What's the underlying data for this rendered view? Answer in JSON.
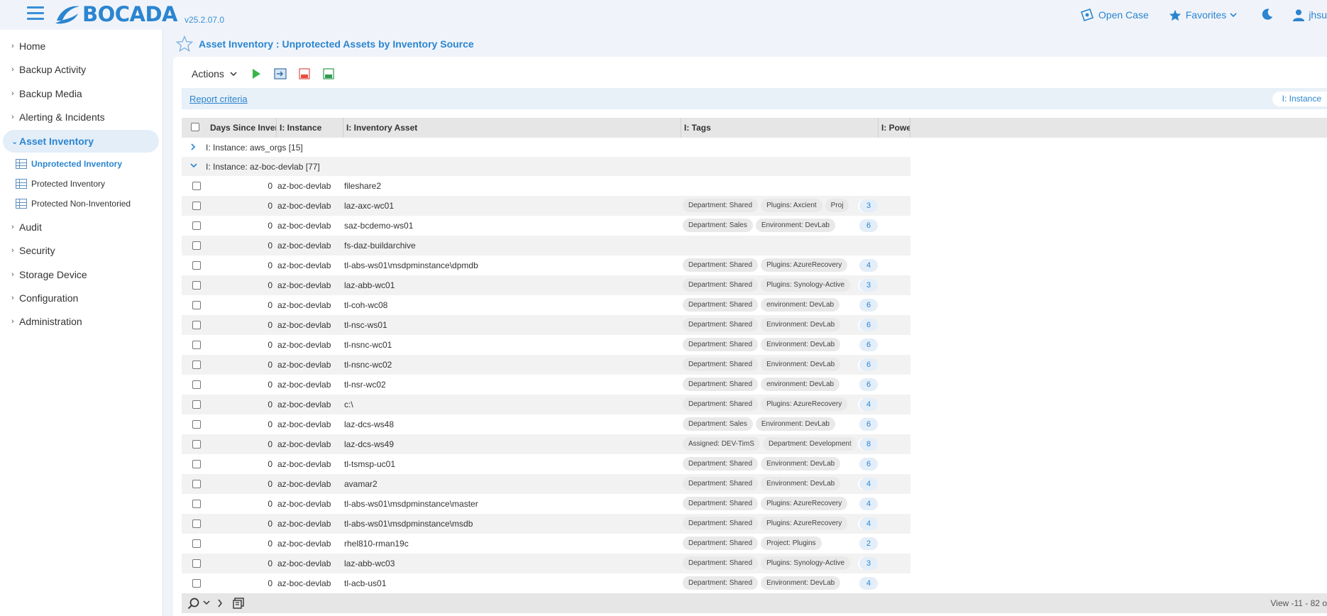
{
  "app": {
    "logo_text": "BOCADA",
    "version": "v25.2.07.0",
    "open_case_label": "Open Case",
    "favorites_label": "Favorites",
    "user_label": "jhsu",
    "accent": "#2b85d0"
  },
  "sidebar": {
    "items": [
      {
        "label": "Home"
      },
      {
        "label": "Backup Activity"
      },
      {
        "label": "Backup Media"
      },
      {
        "label": "Alerting & Incidents"
      },
      {
        "label": "Asset Inventory"
      },
      {
        "label": "Audit"
      },
      {
        "label": "Security"
      },
      {
        "label": "Storage Device"
      },
      {
        "label": "Configuration"
      },
      {
        "label": "Administration"
      }
    ],
    "subitems": [
      {
        "label": "Unprotected Inventory"
      },
      {
        "label": "Protected Inventory"
      },
      {
        "label": "Protected Non-Inventoried"
      }
    ]
  },
  "page": {
    "title": "Asset Inventory : Unprotected Assets by Inventory Source",
    "actions_label": "Actions",
    "report_criteria": "Report criteria",
    "group_chip": "I: Instance"
  },
  "grid": {
    "columns": [
      "Days Since Invent",
      "I: Instance",
      "I: Inventory Asset",
      "I: Tags",
      "I: Power"
    ],
    "groups": [
      {
        "label": "I: Instance: aws_orgs [15]",
        "expanded": false
      },
      {
        "label": "I: Instance: az-boc-devlab [77]",
        "expanded": true
      }
    ],
    "rows": [
      {
        "days": "0",
        "instance": "az-boc-devlab",
        "asset": "fileshare2",
        "tags": [],
        "count": ""
      },
      {
        "days": "0",
        "instance": "az-boc-devlab",
        "asset": "laz-axc-wc01",
        "tags": [
          "Department: Shared",
          "Plugins: Axcient",
          "Proj"
        ],
        "count": "3"
      },
      {
        "days": "0",
        "instance": "az-boc-devlab",
        "asset": "saz-bcdemo-ws01",
        "tags": [
          "Department: Sales",
          "Environment: DevLab"
        ],
        "count": "6"
      },
      {
        "days": "0",
        "instance": "az-boc-devlab",
        "asset": "fs-daz-buildarchive",
        "tags": [],
        "count": ""
      },
      {
        "days": "0",
        "instance": "az-boc-devlab",
        "asset": "tl-abs-ws01\\msdpminstance\\dpmdb",
        "tags": [
          "Department: Shared",
          "Plugins: AzureRecovery"
        ],
        "count": "4"
      },
      {
        "days": "0",
        "instance": "az-boc-devlab",
        "asset": "laz-abb-wc01",
        "tags": [
          "Department: Shared",
          "Plugins: Synology-Active"
        ],
        "count": "3"
      },
      {
        "days": "0",
        "instance": "az-boc-devlab",
        "asset": "tl-coh-wc08",
        "tags": [
          "Department: Shared",
          "environment: DevLab"
        ],
        "count": "6"
      },
      {
        "days": "0",
        "instance": "az-boc-devlab",
        "asset": "tl-nsc-ws01",
        "tags": [
          "Department: Shared",
          "Environment: DevLab"
        ],
        "count": "6"
      },
      {
        "days": "0",
        "instance": "az-boc-devlab",
        "asset": "tl-nsnc-wc01",
        "tags": [
          "Department: Shared",
          "Environment: DevLab"
        ],
        "count": "6"
      },
      {
        "days": "0",
        "instance": "az-boc-devlab",
        "asset": "tl-nsnc-wc02",
        "tags": [
          "Department: Shared",
          "Environment: DevLab"
        ],
        "count": "6"
      },
      {
        "days": "0",
        "instance": "az-boc-devlab",
        "asset": "tl-nsr-wc02",
        "tags": [
          "Department: Shared",
          "environment: DevLab"
        ],
        "count": "6"
      },
      {
        "days": "0",
        "instance": "az-boc-devlab",
        "asset": "c:\\",
        "tags": [
          "Department: Shared",
          "Plugins: AzureRecovery"
        ],
        "count": "4"
      },
      {
        "days": "0",
        "instance": "az-boc-devlab",
        "asset": "laz-dcs-ws48",
        "tags": [
          "Department: Sales",
          "Environment: DevLab"
        ],
        "count": "6"
      },
      {
        "days": "0",
        "instance": "az-boc-devlab",
        "asset": "laz-dcs-ws49",
        "tags": [
          "Assigned: DEV-TimS",
          "Department: Development"
        ],
        "count": "8"
      },
      {
        "days": "0",
        "instance": "az-boc-devlab",
        "asset": "tl-tsmsp-uc01",
        "tags": [
          "Department: Shared",
          "Environment: DevLab"
        ],
        "count": "6"
      },
      {
        "days": "0",
        "instance": "az-boc-devlab",
        "asset": "avamar2",
        "tags": [
          "Department: Shared",
          "Environment: DevLab"
        ],
        "count": "4"
      },
      {
        "days": "0",
        "instance": "az-boc-devlab",
        "asset": "tl-abs-ws01\\msdpminstance\\master",
        "tags": [
          "Department: Shared",
          "Plugins: AzureRecovery"
        ],
        "count": "4"
      },
      {
        "days": "0",
        "instance": "az-boc-devlab",
        "asset": "tl-abs-ws01\\msdpminstance\\msdb",
        "tags": [
          "Department: Shared",
          "Plugins: AzureRecovery"
        ],
        "count": "4"
      },
      {
        "days": "0",
        "instance": "az-boc-devlab",
        "asset": "rhel810-rman19c",
        "tags": [
          "Department: Shared",
          "Project: Plugins"
        ],
        "count": "2"
      },
      {
        "days": "0",
        "instance": "az-boc-devlab",
        "asset": "laz-abb-wc03",
        "tags": [
          "Department: Shared",
          "Plugins: Synology-Active"
        ],
        "count": "3"
      },
      {
        "days": "0",
        "instance": "az-boc-devlab",
        "asset": "tl-acb-us01",
        "tags": [
          "Department: Shared",
          "Environment: DevLab"
        ],
        "count": "4"
      }
    ]
  },
  "footer": {
    "view_text": "View -11 - 82 o"
  }
}
